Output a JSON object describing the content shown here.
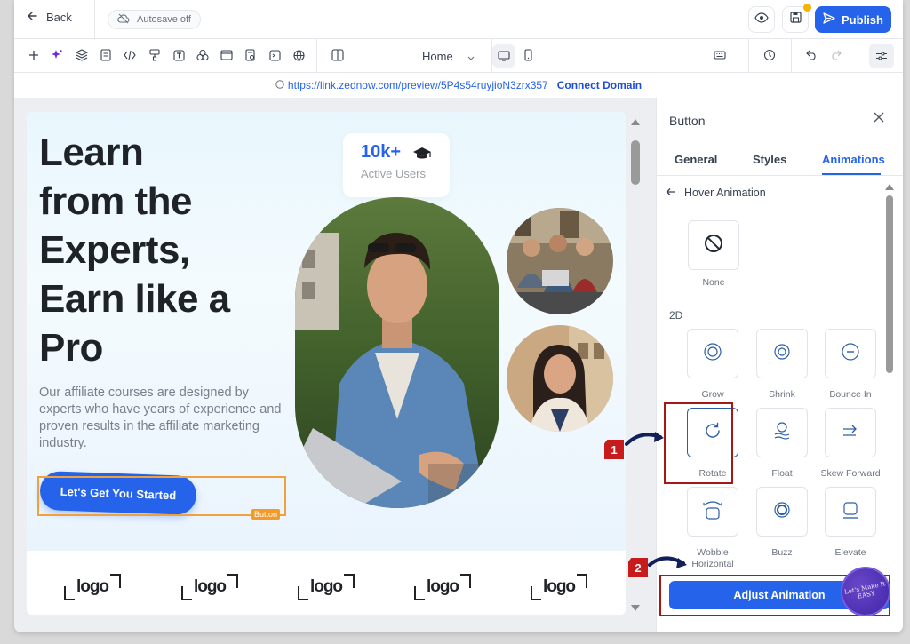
{
  "header": {
    "back_label": "Back",
    "autosave_label": "Autosave off",
    "publish_label": "Publish"
  },
  "toolbar": {
    "page_select_value": "Home"
  },
  "url_bar": {
    "url": "https://link.zednow.com/preview/5P4s54ruyjioN3zrx357",
    "connect_label": "Connect Domain"
  },
  "preview": {
    "hero_title_lines": [
      "Learn",
      "from the",
      "Experts,",
      "Earn like a",
      "Pro"
    ],
    "hero_description": "Our affiliate courses are designed by experts who have years of experience and proven results in the affiliate marketing industry.",
    "cta_label": "Let's Get You Started",
    "selection_label": "Button",
    "stat_value": "10k+",
    "stat_label": "Active Users",
    "logos": [
      "logo",
      "logo",
      "logo",
      "logo",
      "logo"
    ]
  },
  "panel": {
    "title": "Button",
    "tabs": [
      "General",
      "Styles",
      "Animations"
    ],
    "active_tab": "Animations",
    "sub_heading": "Hover Animation",
    "none_label": "None",
    "section_label": "2D",
    "animations": [
      {
        "label": "Grow",
        "icon": "grow-icon"
      },
      {
        "label": "Shrink",
        "icon": "shrink-icon"
      },
      {
        "label": "Bounce In",
        "icon": "bounce-in-icon"
      },
      {
        "label": "Rotate",
        "icon": "rotate-icon"
      },
      {
        "label": "Float",
        "icon": "float-icon"
      },
      {
        "label": "Skew Forward",
        "icon": "skew-forward-icon"
      },
      {
        "label": "Wobble\nHorizontal",
        "icon": "wobble-horizontal-icon"
      },
      {
        "label": "Buzz",
        "icon": "buzz-icon"
      },
      {
        "label": "Elevate",
        "icon": "elevate-icon"
      }
    ],
    "selected_animation": "Rotate",
    "adjust_label": "Adjust Animation"
  },
  "annotations": {
    "step1": "1",
    "step2": "2",
    "watermark_text": "Let's Make It EASY"
  },
  "colors": {
    "accent": "#2563eb",
    "highlight": "#a41818",
    "selection": "#f0a03c"
  }
}
